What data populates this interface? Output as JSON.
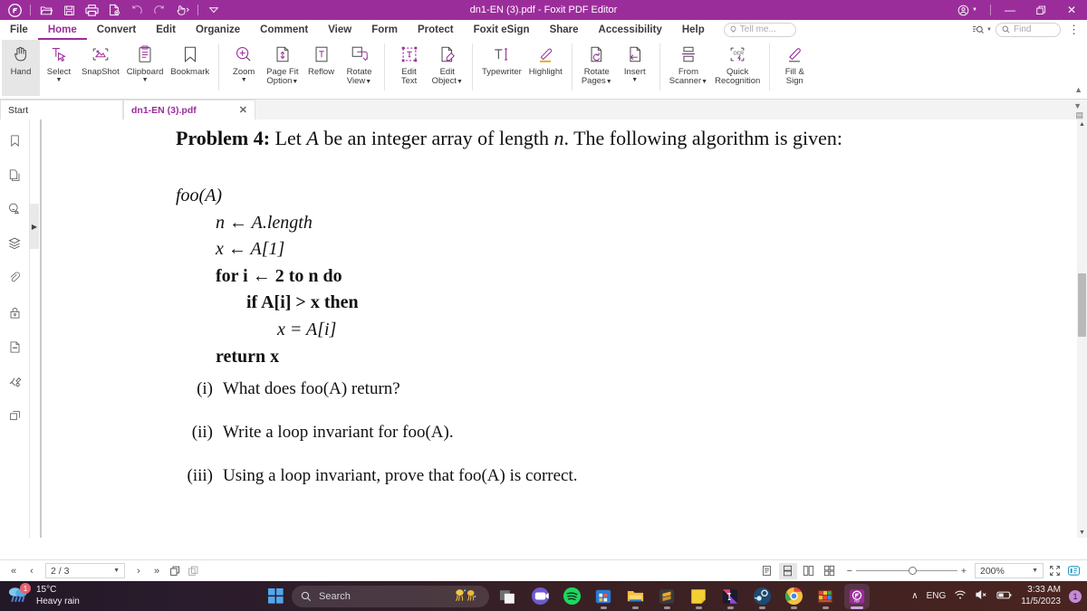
{
  "window": {
    "title": "dn1-EN (3).pdf - Foxit PDF Editor",
    "quick_access": [
      "foxit-logo-icon",
      "open-icon",
      "save-icon",
      "print-icon",
      "create-pdf-icon",
      "undo-icon",
      "redo-icon",
      "touch-mode-icon",
      "customize-caret-icon"
    ],
    "account_label": "account-icon",
    "minimize_label": "—",
    "restore_label": "❐",
    "close_label": "✕"
  },
  "menubar": {
    "items": [
      {
        "label": "File",
        "active": false
      },
      {
        "label": "Home",
        "active": true
      },
      {
        "label": "Convert",
        "active": false
      },
      {
        "label": "Edit",
        "active": false
      },
      {
        "label": "Organize",
        "active": false
      },
      {
        "label": "Comment",
        "active": false
      },
      {
        "label": "View",
        "active": false
      },
      {
        "label": "Form",
        "active": false
      },
      {
        "label": "Protect",
        "active": false
      },
      {
        "label": "Foxit eSign",
        "active": false
      },
      {
        "label": "Share",
        "active": false
      },
      {
        "label": "Accessibility",
        "active": false
      },
      {
        "label": "Help",
        "active": false
      }
    ],
    "tell_me_placeholder": "Tell me...",
    "find_placeholder": "Find",
    "kebab_label": "⋮"
  },
  "ribbon": {
    "groups": [
      {
        "buttons": [
          {
            "icon": "hand-icon",
            "line1": "Hand",
            "line2": "",
            "caret": false,
            "selected": true
          },
          {
            "icon": "select-icon",
            "line1": "Select",
            "line2": "",
            "caret": true,
            "selected": false
          },
          {
            "icon": "snapshot-icon",
            "line1": "SnapShot",
            "line2": "",
            "caret": false,
            "selected": false
          },
          {
            "icon": "clipboard-icon",
            "line1": "Clipboard",
            "line2": "",
            "caret": true,
            "selected": false
          },
          {
            "icon": "bookmark-icon",
            "line1": "Bookmark",
            "line2": "",
            "caret": false,
            "selected": false
          }
        ]
      },
      {
        "buttons": [
          {
            "icon": "zoom-icon",
            "line1": "Zoom",
            "line2": "",
            "caret": true,
            "selected": false
          },
          {
            "icon": "page-fit-icon",
            "line1": "Page Fit",
            "line2": "Option",
            "caret": true,
            "selected": false
          },
          {
            "icon": "reflow-icon",
            "line1": "Reflow",
            "line2": "",
            "caret": false,
            "selected": false
          },
          {
            "icon": "rotate-view-icon",
            "line1": "Rotate",
            "line2": "View",
            "caret": true,
            "selected": false
          }
        ]
      },
      {
        "buttons": [
          {
            "icon": "edit-text-icon",
            "line1": "Edit",
            "line2": "Text",
            "caret": false,
            "selected": false
          },
          {
            "icon": "edit-object-icon",
            "line1": "Edit",
            "line2": "Object",
            "caret": true,
            "selected": false
          }
        ]
      },
      {
        "buttons": [
          {
            "icon": "typewriter-icon",
            "line1": "Typewriter",
            "line2": "",
            "caret": false,
            "selected": false
          },
          {
            "icon": "highlight-icon",
            "line1": "Highlight",
            "line2": "",
            "caret": false,
            "selected": false
          }
        ]
      },
      {
        "buttons": [
          {
            "icon": "rotate-pages-icon",
            "line1": "Rotate",
            "line2": "Pages",
            "caret": true,
            "selected": false
          },
          {
            "icon": "insert-pages-icon",
            "line1": "Insert",
            "line2": "",
            "caret": true,
            "selected": false
          }
        ]
      },
      {
        "buttons": [
          {
            "icon": "from-scanner-icon",
            "line1": "From",
            "line2": "Scanner",
            "caret": true,
            "selected": false
          },
          {
            "icon": "quick-recognition-icon",
            "line1": "Quick",
            "line2": "Recognition",
            "caret": false,
            "selected": false
          }
        ]
      },
      {
        "buttons": [
          {
            "icon": "fill-and-sign-icon",
            "line1": "Fill &",
            "line2": "Sign",
            "caret": false,
            "selected": false
          }
        ]
      }
    ]
  },
  "tabstrip": {
    "tabs": [
      {
        "label": "Start",
        "active": false,
        "closable": false
      },
      {
        "label": "dn1-EN (3).pdf",
        "active": true,
        "closable": true
      }
    ],
    "close_label": "✕"
  },
  "left_rail": {
    "items": [
      {
        "icon": "bookmark-panel-icon"
      },
      {
        "icon": "pages-panel-icon"
      },
      {
        "icon": "comments-panel-icon"
      },
      {
        "icon": "layers-panel-icon"
      },
      {
        "icon": "attachments-panel-icon"
      },
      {
        "icon": "security-panel-icon"
      },
      {
        "icon": "fields-panel-icon"
      },
      {
        "icon": "signatures-panel-icon"
      },
      {
        "icon": "stamps-panel-icon"
      }
    ],
    "expand_label": "▶"
  },
  "document": {
    "problem_heading_bold": "Problem 4:",
    "problem_heading_rest": " Let A be an integer array of length n. The following algorithm is given:",
    "problem_parts": {
      "lead_bold": "Problem 4:",
      "text_1": "Let",
      "var_A": "A",
      "text_2": "be an integer array of length",
      "var_n": "n",
      "text_3": ". The following algorithm is given:"
    },
    "algorithm": {
      "name": "foo(A)",
      "lines": [
        "foo(A)",
        "n ← A.length",
        "x ← A[1]",
        "for  i ← 2 to  n do",
        "if  A[i] > x then",
        "x = A[i]",
        "return x"
      ]
    },
    "questions": [
      {
        "num": "(i)",
        "text": "What does foo(A) return?"
      },
      {
        "num": "(ii)",
        "text": "Write a loop invariant for foo(A)."
      },
      {
        "num": "(iii)",
        "text": "Using a loop invariant, prove that foo(A) is correct."
      }
    ]
  },
  "statusbar": {
    "first_page_label": "«",
    "prev_page_label": "‹",
    "page_value": "2 / 3",
    "next_page_label": "›",
    "last_page_label": "»",
    "copy_page_icon": "duplicate-page-icon",
    "compare_icon": "compare-pages-icon",
    "view_modes": [
      {
        "icon": "single-page-view-icon",
        "selected": false
      },
      {
        "icon": "continuous-view-icon",
        "selected": true
      },
      {
        "icon": "facing-view-icon",
        "selected": false
      },
      {
        "icon": "facing-continuous-view-icon",
        "selected": false
      }
    ],
    "zoom_out_label": "−",
    "zoom_in_label": "+",
    "zoom_value": "200%",
    "fullscreen_icon": "fullscreen-icon",
    "reading_mode_icon": "reading-mode-icon"
  },
  "taskbar": {
    "weather": {
      "temp": "15°C",
      "condition": "Heavy rain",
      "badge": "1",
      "icon": "rain-icon"
    },
    "start_icon": "windows-start-icon",
    "search_placeholder": "Search",
    "search_decor_icon": "jellyfish-icon",
    "apps": [
      {
        "icon": "task-view-icon",
        "name": "task-view",
        "active": false
      },
      {
        "icon": "teams-icon",
        "name": "microsoft-teams",
        "active": false
      },
      {
        "icon": "spotify-icon",
        "name": "spotify",
        "active": false
      },
      {
        "icon": "store-icon",
        "name": "microsoft-store",
        "active": false
      },
      {
        "icon": "file-explorer-icon",
        "name": "file-explorer",
        "active": false
      },
      {
        "icon": "sublime-icon",
        "name": "sublime-text",
        "active": false
      },
      {
        "icon": "sticky-notes-icon",
        "name": "sticky-notes",
        "active": false
      },
      {
        "icon": "intellij-icon",
        "name": "intellij-idea",
        "active": false
      },
      {
        "icon": "steam-icon",
        "name": "steam",
        "active": false
      },
      {
        "icon": "chrome-icon",
        "name": "google-chrome",
        "active": false
      },
      {
        "icon": "winrar-icon",
        "name": "winrar",
        "active": false
      },
      {
        "icon": "foxit-icon",
        "name": "foxit-pdf-editor",
        "active": true
      }
    ],
    "tray": {
      "chevron_label": "∧",
      "language": "ENG",
      "wifi_icon": "wifi-icon",
      "volume_icon": "volume-muted-icon",
      "battery_icon": "battery-icon",
      "time": "3:33 AM",
      "date": "11/5/2023",
      "notification_count": "1"
    }
  },
  "colors": {
    "brand_purple": "#9b2d9b",
    "accent_text": "#9b2d9b",
    "taskbar_left": "#231827",
    "taskbar_right": "#4a2420"
  }
}
